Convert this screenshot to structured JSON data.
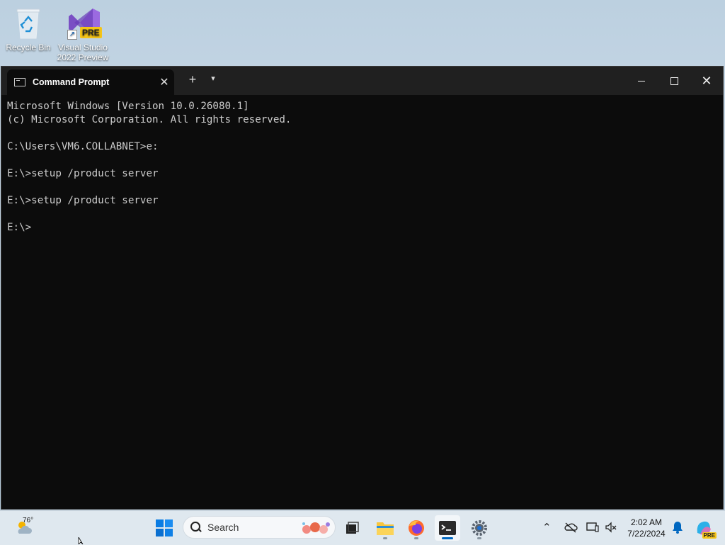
{
  "desktop": {
    "icons": [
      {
        "label_line1": "Recycle Bin",
        "label_line2": ""
      },
      {
        "label_line1": "Visual Studio",
        "label_line2": "2022 Preview",
        "badge": "PRE"
      }
    ]
  },
  "window": {
    "tab_title": "Command Prompt",
    "console_lines": [
      "Microsoft Windows [Version 10.0.26080.1]",
      "(c) Microsoft Corporation. All rights reserved.",
      "",
      "C:\\Users\\VM6.COLLABNET>e:",
      "",
      "E:\\>setup /product server",
      "",
      "E:\\>setup /product server",
      "",
      "E:\\>"
    ],
    "colors": {
      "background": "#0c0c0c",
      "text": "#cccccc",
      "titlebar": "#202020"
    }
  },
  "taskbar": {
    "weather_temp": "76°",
    "search_placeholder": "Search",
    "clock_time": "2:02 AM",
    "clock_date": "7/22/2024",
    "copilot_badge": "PRE",
    "apps": [
      "start-icon",
      "search-icon",
      "task-view-icon",
      "file-explorer-icon",
      "firefox-icon",
      "terminal-icon",
      "settings-icon"
    ],
    "accent": "#0067c0"
  }
}
